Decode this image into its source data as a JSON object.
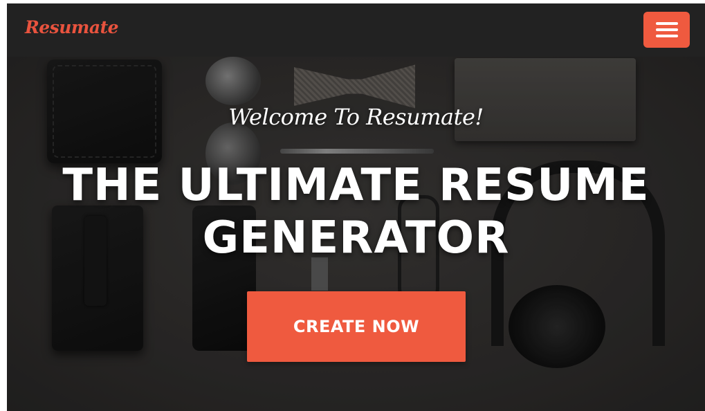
{
  "navbar": {
    "brand": "Resumate",
    "menu_icon": "hamburger-menu-icon"
  },
  "hero": {
    "tagline": "Welcome To Resumate!",
    "headline_line1": "THE ULTIMATE RESUME",
    "headline_line2": "GENERATOR",
    "cta_label": "CREATE NOW"
  },
  "colors": {
    "accent": "#ef5a3f",
    "navbar_bg": "#222222",
    "text_light": "#ffffff"
  }
}
